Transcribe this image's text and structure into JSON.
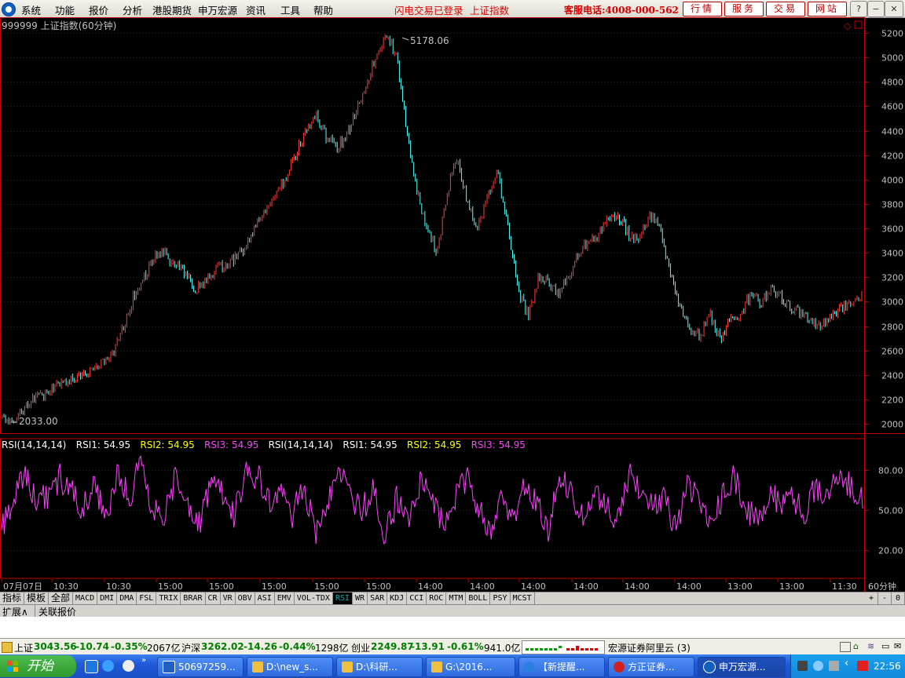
{
  "menu": {
    "items": [
      "系统",
      "功能",
      "报价",
      "分析",
      "港股期货",
      "申万宏源",
      "资讯",
      "工具",
      "帮助"
    ],
    "notices": [
      "闪电交易已登录",
      "上证指数"
    ],
    "hotline": "客服电话:4008-000-562",
    "buttons": [
      "行情",
      "服务",
      "交易",
      "网站"
    ],
    "win_buttons": [
      "?",
      "−",
      "❐",
      "✕"
    ]
  },
  "chart": {
    "title": "999999 上证指数(60分钟)",
    "high_label": "5178.06",
    "low_label": "2033.00",
    "y_ticks": [
      "5200",
      "5000",
      "4800",
      "4600",
      "4400",
      "4200",
      "4000",
      "3800",
      "3600",
      "3400",
      "3200",
      "3000",
      "2800",
      "2600",
      "2400",
      "2200",
      "2000"
    ],
    "indicator_header": [
      {
        "text": "RSI(14,14,14)",
        "color": "#ffffff"
      },
      {
        "text": "RSI1: 54.95",
        "color": "#ffffff"
      },
      {
        "text": "RSI2: 54.95",
        "color": "#ffff00"
      },
      {
        "text": "RSI3: 54.95",
        "color": "#ff40ff"
      },
      {
        "text": "RSI(14,14,14)",
        "color": "#ffffff"
      },
      {
        "text": "RSI1: 54.95",
        "color": "#ffffff"
      },
      {
        "text": "RSI2: 54.95",
        "color": "#ffff00"
      },
      {
        "text": "RSI3: 54.95",
        "color": "#ff40ff"
      }
    ],
    "rsi_ticks": [
      "80.00",
      "50.00",
      "20.00"
    ],
    "time_labels": [
      "07月07日",
      "10:30",
      "10:30",
      "15:00",
      "15:00",
      "15:00",
      "15:00",
      "15:00",
      "14:00",
      "14:00",
      "14:00",
      "14:00",
      "14:00",
      "14:00",
      "13:00",
      "13:00",
      "11:30"
    ],
    "period_label": "60分钟",
    "colors": {
      "up": "#ff3c3c",
      "down": "#54ffff",
      "grid": "#8b0000",
      "rsi": "#ff40ff",
      "axis": "#c00000",
      "text": "#c0c0c0"
    }
  },
  "chart_data": {
    "type": "line",
    "title": "999999 上证指数(60分钟)",
    "ylim": [
      2000,
      5200
    ],
    "series": [
      {
        "name": "上证指数",
        "values": [
          2040,
          2033,
          2120,
          2200,
          2230,
          2300,
          2350,
          2380,
          2400,
          2450,
          2500,
          2600,
          2800,
          3050,
          3200,
          3350,
          3400,
          3300,
          3250,
          3100,
          3150,
          3250,
          3300,
          3350,
          3450,
          3600,
          3750,
          3850,
          4000,
          4200,
          4400,
          4550,
          4350,
          4250,
          4350,
          4550,
          4800,
          5000,
          5178,
          5000,
          4400,
          3900,
          3600,
          3400,
          3900,
          4200,
          3800,
          3600,
          3850,
          4050,
          3600,
          3100,
          2880,
          3200,
          3150,
          3050,
          3200,
          3400,
          3500,
          3550,
          3700,
          3680,
          3550,
          3500,
          3700,
          3650,
          3250,
          2950,
          2800,
          2700,
          2900,
          2700,
          2850,
          2900,
          3050,
          3000,
          3100,
          3050,
          2950,
          2900,
          2850,
          2800,
          2900,
          2950,
          3000,
          3050
        ]
      },
      {
        "name": "RSI(14,14,14)",
        "values": [
          35,
          60,
          80,
          55,
          60,
          75,
          65,
          50,
          70,
          40,
          80,
          60,
          85,
          50,
          45,
          75,
          55,
          40,
          70,
          60,
          45,
          80,
          75,
          55,
          60,
          45,
          70,
          30,
          55,
          80,
          60,
          50,
          65,
          30,
          60,
          45,
          70,
          55,
          40,
          60,
          75,
          50,
          30,
          60,
          45,
          70,
          55,
          35,
          75,
          60,
          45,
          65,
          55,
          40,
          80,
          65,
          50,
          60,
          35,
          70,
          55,
          45,
          60,
          75,
          50,
          40,
          65,
          55,
          60,
          45,
          70,
          55,
          80,
          65,
          55
        ]
      }
    ],
    "y_ticks": [
      2000,
      2200,
      2400,
      2600,
      2800,
      3000,
      3200,
      3400,
      3600,
      3800,
      4000,
      4200,
      4400,
      4600,
      4800,
      5000,
      5200
    ],
    "rsi_ticks": [
      20,
      50,
      80
    ],
    "annotations": [
      "5178.06",
      "2033.00"
    ],
    "legend": "top-left"
  },
  "tabs": {
    "lead": [
      "指标",
      "模板",
      "全部"
    ],
    "indicators": [
      "MACD",
      "DMI",
      "DMA",
      "FSL",
      "TRIX",
      "BRAR",
      "CR",
      "VR",
      "OBV",
      "ASI",
      "EMV",
      "VOL-TDX",
      "RSI",
      "WR",
      "SAR",
      "KDJ",
      "CCI",
      "ROC",
      "MTM",
      "BOLL",
      "PSY",
      "MCST"
    ],
    "active": "RSI",
    "right": [
      "+",
      "-",
      "0"
    ],
    "row2": [
      "扩展∧",
      "关联报价"
    ]
  },
  "status": {
    "sh_label": "上证",
    "sh_value": "3043.56",
    "sh_change": "-10.74",
    "sh_pct": "-0.35%",
    "sh_amount": "2067亿",
    "hs_label": "沪深",
    "hs_value": "3262.02",
    "hs_change": "-14.26",
    "hs_pct": "-0.44%",
    "hs_amount": "1298亿",
    "cy_label": "创业",
    "cy_value": "2249.87",
    "cy_change": "-13.91",
    "cy_pct": "-0.61%",
    "cy_amount": "941.0亿",
    "server": "宏源证券阿里云 (3)"
  },
  "taskbar": {
    "start": "开始",
    "tasks": [
      "50697259...",
      "D:\\new_s...",
      "D:\\科研...",
      "G:\\2016...",
      "【新提醒...",
      "方正证券...",
      "申万宏源..."
    ],
    "time": "22:56"
  }
}
